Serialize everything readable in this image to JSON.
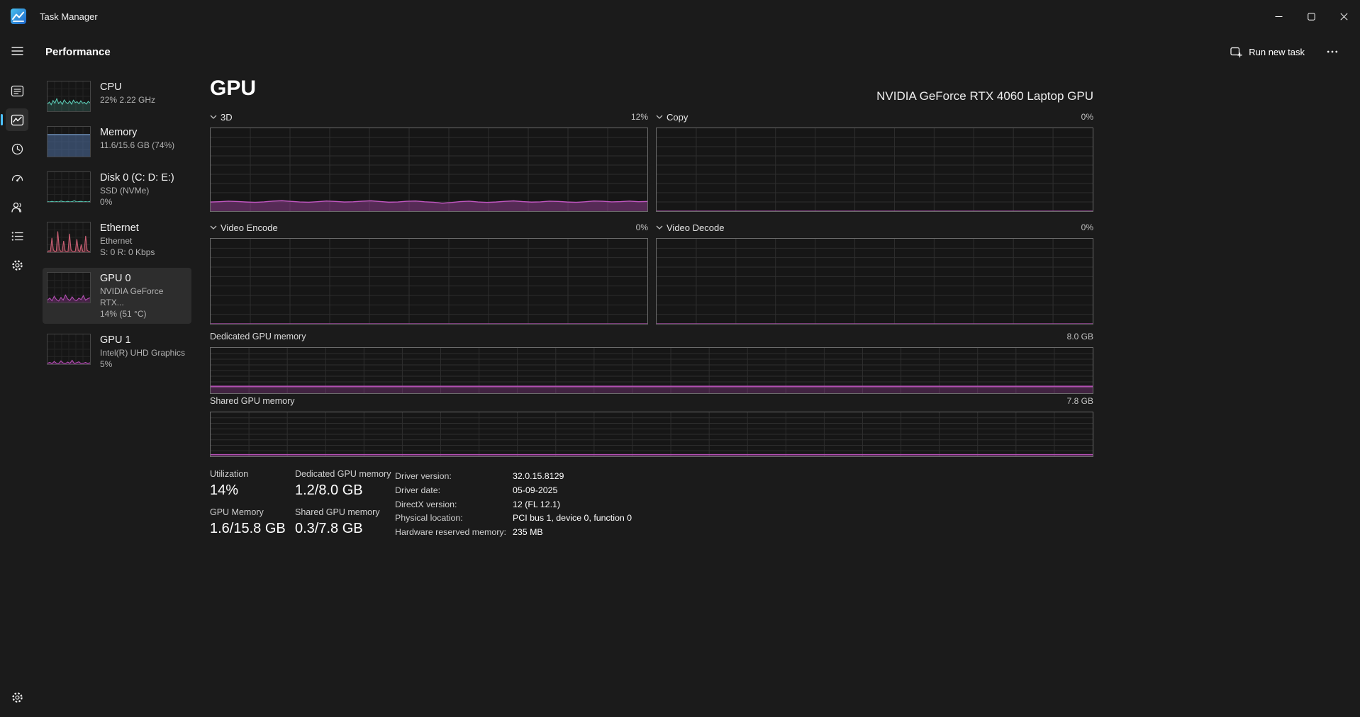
{
  "titlebar": {
    "title": "Task Manager"
  },
  "header": {
    "title": "Performance",
    "run_new_task_label": "Run new task"
  },
  "sidebar": {
    "items": [
      {
        "title": "CPU",
        "lines": [
          "22%  2.22 GHz"
        ]
      },
      {
        "title": "Memory",
        "lines": [
          "11.6/15.6 GB (74%)"
        ]
      },
      {
        "title": "Disk 0 (C: D: E:)",
        "lines": [
          "SSD (NVMe)",
          "0%"
        ]
      },
      {
        "title": "Ethernet",
        "lines": [
          "Ethernet",
          "S: 0 R: 0 Kbps"
        ]
      },
      {
        "title": "GPU 0",
        "lines": [
          "NVIDIA GeForce RTX...",
          "14% (51 °C)"
        ]
      },
      {
        "title": "GPU 1",
        "lines": [
          "Intel(R) UHD Graphics",
          "5%"
        ]
      }
    ]
  },
  "main": {
    "title": "GPU",
    "device_name": "NVIDIA GeForce RTX 4060 Laptop GPU",
    "engine_charts": [
      {
        "label": "3D",
        "value": "12%"
      },
      {
        "label": "Copy",
        "value": "0%"
      },
      {
        "label": "Video Encode",
        "value": "0%"
      },
      {
        "label": "Video Decode",
        "value": "0%"
      }
    ],
    "memory_charts": [
      {
        "label": "Dedicated GPU memory",
        "value": "8.0 GB"
      },
      {
        "label": "Shared GPU memory",
        "value": "7.8 GB"
      }
    ],
    "stats": [
      {
        "label": "Utilization",
        "value": "14%"
      },
      {
        "label": "Dedicated GPU memory",
        "value": "1.2/8.0 GB"
      },
      {
        "label": "GPU Memory",
        "value": "1.6/15.8 GB"
      },
      {
        "label": "Shared GPU memory",
        "value": "0.3/7.8 GB"
      }
    ],
    "details": [
      {
        "label": "Driver version:",
        "value": "32.0.15.8129"
      },
      {
        "label": "Driver date:",
        "value": "05-09-2025"
      },
      {
        "label": "DirectX version:",
        "value": "12 (FL 12.1)"
      },
      {
        "label": "Physical location:",
        "value": "PCI bus 1, device 0, function 0"
      },
      {
        "label": "Hardware reserved memory:",
        "value": "235 MB"
      }
    ]
  },
  "colors": {
    "accent": "#4cc2ff",
    "gpu_purple": "#b14fb1",
    "cpu_teal": "#58c7b2",
    "memory_blue": "#7aa3d4",
    "ethernet_pink": "#c95f73",
    "chart_background": "#161616",
    "chart_border": "#6b6b6b"
  },
  "chart_data": {
    "charts": {
      "gpu_3d": {
        "type": "area",
        "title": "3D",
        "unit": "%",
        "current": "12%",
        "ylim": [
          0,
          100
        ],
        "max": 100,
        "color": "#c157c1",
        "fill": "rgba(164,67,164,0.45)",
        "line_width": 1.4,
        "grid": {
          "cols": 11,
          "rows": 9
        },
        "grid_color": "#2e2e2e",
        "values": [
          11,
          11.4,
          12,
          11.6,
          11,
          10.6,
          11.2,
          12.1,
          12.6,
          11.8,
          11.1,
          10.7,
          11.4,
          12.2,
          11.7,
          11,
          11.3,
          12,
          12.5,
          11.6,
          10.8,
          11.1,
          11.9,
          12.2,
          11.3,
          10.7,
          9.6,
          10.4,
          11.5,
          12,
          11.1,
          10.5,
          11,
          11.8,
          12.4,
          11.5,
          10.9,
          11.2,
          12,
          11.7,
          11,
          10.6,
          11.3,
          12.2,
          11.9,
          11.2,
          11.5,
          12.1,
          11.4,
          11.7
        ]
      },
      "gpu_copy": {
        "type": "area",
        "title": "Copy",
        "unit": "%",
        "current": "0%",
        "ylim": [
          0,
          100
        ],
        "max": 100,
        "color": "#b14fb1",
        "fill": "none",
        "line_width": 1.2,
        "grid": {
          "cols": 11,
          "rows": 9
        },
        "grid_color": "#2e2e2e",
        "values": [
          0,
          0
        ]
      },
      "gpu_video_encode": {
        "type": "area",
        "title": "Video Encode",
        "unit": "%",
        "current": "0%",
        "ylim": [
          0,
          100
        ],
        "max": 100,
        "color": "#b14fb1",
        "fill": "none",
        "line_width": 1.2,
        "grid": {
          "cols": 11,
          "rows": 9
        },
        "grid_color": "#2e2e2e",
        "values": [
          0,
          0
        ]
      },
      "gpu_video_decode": {
        "type": "area",
        "title": "Video Decode",
        "unit": "%",
        "current": "0%",
        "ylim": [
          0,
          100
        ],
        "max": 100,
        "color": "#b14fb1",
        "fill": "none",
        "line_width": 1.2,
        "grid": {
          "cols": 11,
          "rows": 9
        },
        "grid_color": "#2e2e2e",
        "values": [
          0,
          0
        ]
      },
      "gpu_dedicated_memory": {
        "type": "area",
        "title": "Dedicated GPU memory",
        "unit": "GB",
        "current": "1.2/8.0 GB",
        "ylim": [
          0,
          8.0
        ],
        "max": 8.0,
        "color": "#b14fb1",
        "fill": "rgba(164,67,164,0.3)",
        "line_width": 2,
        "grid": {
          "cols": 23,
          "rows": 8
        },
        "grid_color": "#2e2e2e",
        "values": [
          1.2,
          1.2
        ]
      },
      "gpu_shared_memory": {
        "type": "area",
        "title": "Shared GPU memory",
        "unit": "GB",
        "current": "0.3/7.8 GB",
        "ylim": [
          0,
          7.8
        ],
        "max": 7.8,
        "color": "#b14fb1",
        "fill": "rgba(164,67,164,0.3)",
        "line_width": 1.5,
        "grid": {
          "cols": 23,
          "rows": 8
        },
        "grid_color": "#2e2e2e",
        "values": [
          0.3,
          0.3
        ]
      },
      "cpu_mini": {
        "type": "area",
        "title": "CPU utilization",
        "unit": "%",
        "current": "22%",
        "ylim": [
          0,
          100
        ],
        "max": 100,
        "color": "#58c7b2",
        "fill": "rgba(88,199,178,0.18)",
        "line_width": 1.1,
        "grid": {
          "cols": 6,
          "rows": 4
        },
        "grid_color": "#242424",
        "values": [
          24,
          31,
          22,
          36,
          27,
          42,
          26,
          33,
          23,
          38,
          30,
          26,
          34,
          24,
          37,
          29,
          32,
          25,
          35,
          27,
          30,
          24,
          33,
          28
        ]
      },
      "memory_mini": {
        "type": "area",
        "title": "Memory usage",
        "unit": "%",
        "current": "74%",
        "ylim": [
          0,
          100
        ],
        "max": 100,
        "color": "#7aa3d4",
        "fill": "rgba(90,130,190,0.45)",
        "line_width": 1.2,
        "grid": {
          "cols": 6,
          "rows": 4
        },
        "grid_color": "#242424",
        "values": [
          74,
          74
        ]
      },
      "disk_mini": {
        "type": "area",
        "title": "Disk activity",
        "unit": "%",
        "current": "0%",
        "ylim": [
          0,
          100
        ],
        "max": 100,
        "color": "#58c7b2",
        "fill": "rgba(88,199,178,0.15)",
        "line_width": 1.1,
        "grid": {
          "cols": 6,
          "rows": 4
        },
        "grid_color": "#242424",
        "values": [
          1,
          0,
          2,
          0,
          1,
          0,
          3,
          1,
          0,
          2,
          0,
          1,
          4,
          0,
          1,
          2,
          0,
          1,
          0,
          2
        ]
      },
      "ethernet_mini": {
        "type": "area",
        "title": "Ethernet throughput",
        "unit": "Kbps",
        "current": "S: 0 R: 0 Kbps",
        "ylim": [
          0,
          100
        ],
        "max": 100,
        "color": "#c95f73",
        "fill": "rgba(201,95,115,0.35)",
        "line_width": 1.1,
        "grid": {
          "cols": 6,
          "rows": 4
        },
        "grid_color": "#242424",
        "values": [
          2,
          5,
          3,
          48,
          8,
          2,
          4,
          70,
          12,
          3,
          2,
          38,
          5,
          2,
          3,
          62,
          9,
          3,
          2,
          4,
          44,
          6,
          2,
          26,
          3,
          2,
          55,
          7,
          3,
          2
        ]
      },
      "gpu0_mini": {
        "type": "area",
        "title": "GPU 0 utilization",
        "unit": "%",
        "current": "14%",
        "ylim": [
          0,
          100
        ],
        "max": 100,
        "color": "#b14fb1",
        "fill": "rgba(160,60,160,0.35)",
        "line_width": 1.1,
        "grid": {
          "cols": 6,
          "rows": 4
        },
        "grid_color": "#242424",
        "values": [
          8,
          15,
          6,
          21,
          10,
          5,
          17,
          8,
          25,
          12,
          7,
          19,
          9,
          6,
          15,
          10,
          23,
          8,
          13,
          16
        ]
      },
      "gpu1_mini": {
        "type": "area",
        "title": "GPU 1 utilization",
        "unit": "%",
        "current": "5%",
        "ylim": [
          0,
          100
        ],
        "max": 100,
        "color": "#b14fb1",
        "fill": "rgba(160,60,160,0.35)",
        "line_width": 1.1,
        "grid": {
          "cols": 6,
          "rows": 4
        },
        "grid_color": "#242424",
        "values": [
          3,
          6,
          2,
          9,
          3,
          2,
          11,
          4,
          2,
          7,
          3,
          13,
          2,
          5,
          8,
          2,
          3,
          6,
          2,
          5
        ]
      }
    }
  }
}
